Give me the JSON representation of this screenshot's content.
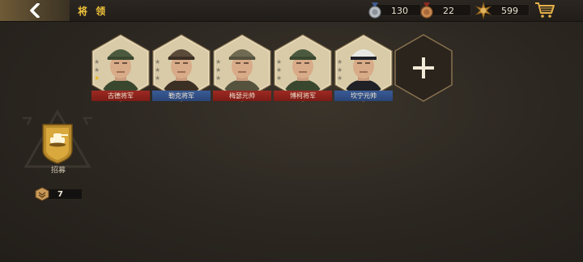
{
  "header": {
    "title": "将 领",
    "resources": [
      {
        "icon": "silver-medal-icon",
        "value": "130"
      },
      {
        "icon": "bronze-medal-icon",
        "value": "22"
      },
      {
        "icon": "war-badge-icon",
        "value": "599"
      }
    ],
    "shop_icon": "shopping-cart-icon"
  },
  "generals": [
    {
      "name": "古德将军",
      "banner": "red",
      "gold_stars": 1,
      "cap": "green-peaked-cap",
      "colors": {
        "banner": "#8f231c"
      }
    },
    {
      "name": "勒克将军",
      "banner": "blue",
      "gold_stars": 0,
      "cap": "kepi",
      "colors": {
        "banner": "#33528a"
      }
    },
    {
      "name": "梅瑟元帅",
      "banner": "red",
      "gold_stars": 0,
      "cap": "garrison-cap",
      "colors": {
        "banner": "#8f231c"
      }
    },
    {
      "name": "博柯将军",
      "banner": "red",
      "gold_stars": 0,
      "cap": "green-peaked-cap",
      "colors": {
        "banner": "#8f231c"
      }
    },
    {
      "name": "坎宁元帅",
      "banner": "blue",
      "gold_stars": 0,
      "cap": "white-naval-cap",
      "colors": {
        "banner": "#33528a"
      }
    }
  ],
  "add_slot_icon": "plus-icon",
  "recruit": {
    "label": "招募",
    "ticket_count": "7",
    "ticket_icon": "recruit-ticket-icon"
  },
  "colors": {
    "accent_gold": "#f0c23a",
    "background": "#2b2620"
  }
}
